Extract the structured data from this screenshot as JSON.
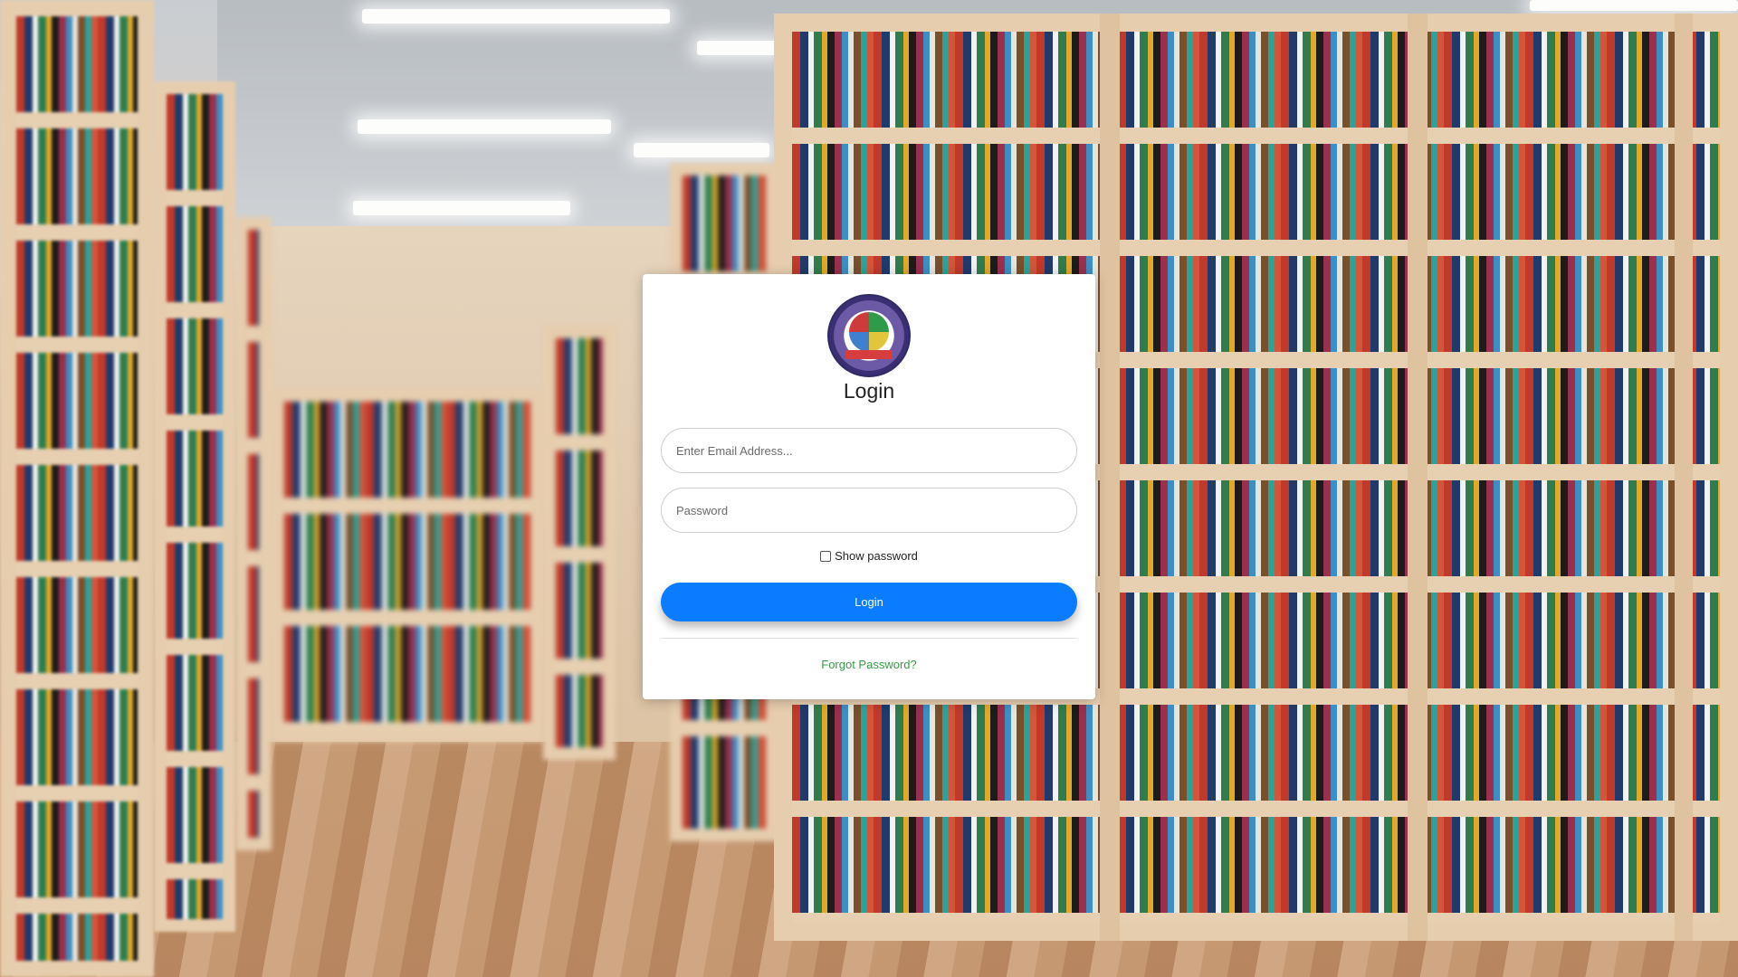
{
  "login": {
    "title": "Login",
    "logo_icon": "school-crest-logo",
    "email_placeholder": "Enter Email Address...",
    "password_placeholder": "Password",
    "show_password_label": "Show password",
    "show_password_checked": false,
    "submit_label": "Login",
    "forgot_password_link": "Forgot Password?"
  },
  "colors": {
    "primary_button": "#0a7cff",
    "forgot_link": "#3a9a48",
    "card_background": "#ffffff"
  },
  "background": {
    "scene": "library-bookshelves-photo"
  }
}
